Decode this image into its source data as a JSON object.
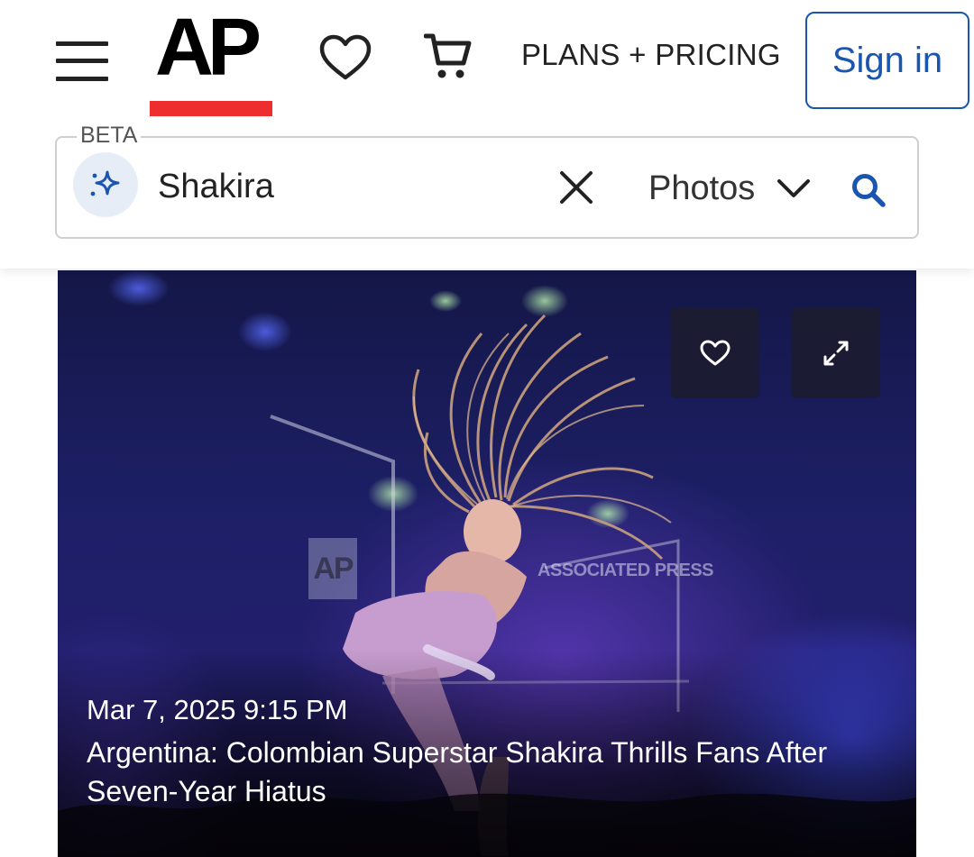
{
  "header": {
    "logo_text": "AP",
    "plans_label": "PLANS + PRICING",
    "signin_label": "Sign in",
    "icons": {
      "menu": "hamburger-menu-icon",
      "favorites": "heart-icon",
      "cart": "cart-icon"
    },
    "colors": {
      "accent_red": "#ee2e2e",
      "link_blue": "#1a56b0"
    }
  },
  "search": {
    "beta_label": "BETA",
    "query": "Shakira",
    "type_label": "Photos",
    "icons": {
      "ai": "sparkle-icon",
      "clear": "close-icon",
      "dropdown": "chevron-down-icon",
      "submit": "search-icon"
    }
  },
  "result": {
    "date": "Mar 7, 2025 9:15 PM",
    "title": "Argentina: Colombian Superstar Shakira Thrills Fans After Seven-Year Hiatus",
    "watermark_logo": "AP",
    "watermark_text": "ASSOCIATED PRESS",
    "icons": {
      "favorite": "heart-icon",
      "expand": "expand-icon"
    }
  }
}
